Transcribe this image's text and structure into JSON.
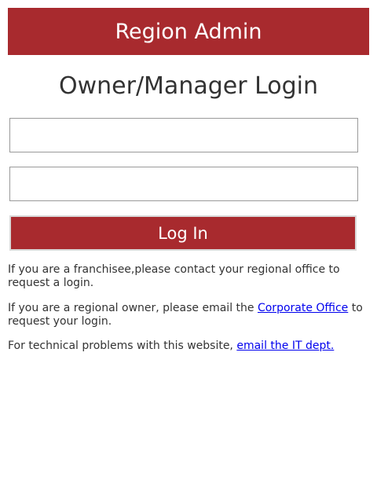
{
  "header": {
    "title": "Region Admin"
  },
  "page_title": "Owner/Manager Login",
  "form": {
    "username": {
      "value": "",
      "placeholder": ""
    },
    "password": {
      "value": "",
      "placeholder": ""
    },
    "login_label": "Log In"
  },
  "info": {
    "franchisee": "If you are a franchisee,please contact your regional office to request a login.",
    "regional_prefix": "If you are a regional owner, please email the ",
    "corporate_link": "Corporate Office",
    "regional_suffix": " to request your login.",
    "technical_prefix": "For technical problems with this website, ",
    "it_link": "email the IT dept."
  },
  "colors": {
    "brand": "#a82a2e",
    "link": "#0000ee",
    "text": "#333333"
  }
}
